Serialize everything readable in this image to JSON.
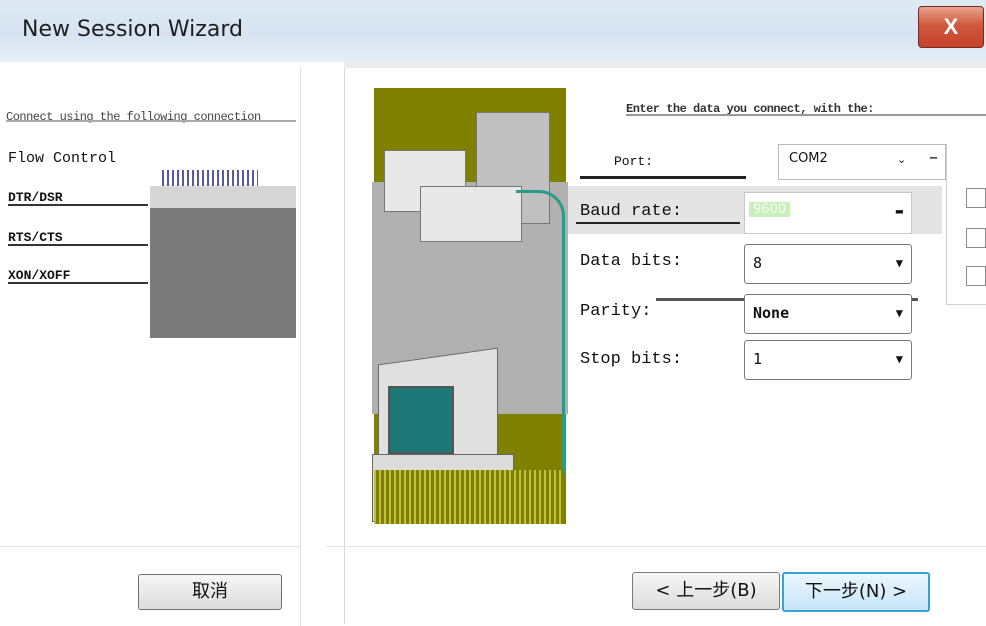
{
  "window": {
    "title": "New Session Wizard",
    "close_label": "X"
  },
  "left_panel": {
    "header_text": "Connect using the following connection",
    "flow_control_label": "Flow Control",
    "flow_items": [
      "DTR/DSR",
      "RTS/CTS",
      "XON/XOFF"
    ]
  },
  "right_panel": {
    "intro_text": "Enter the data you connect, with the:",
    "port": {
      "label": "Port:",
      "value": "COM2"
    },
    "fields": {
      "baud_rate": {
        "label": "Baud rate:",
        "value": "9600"
      },
      "data_bits": {
        "label": "Data bits:",
        "value": "8"
      },
      "parity": {
        "label": "Parity:",
        "value": "None"
      },
      "stop_bits": {
        "label": "Stop bits:",
        "value": "1"
      }
    }
  },
  "buttons": {
    "cancel": "取消",
    "back": "< 上一步(B)",
    "next": "下一步(N) >"
  },
  "icons": {
    "dropdown": "chevron-down-icon",
    "close": "close-icon"
  }
}
